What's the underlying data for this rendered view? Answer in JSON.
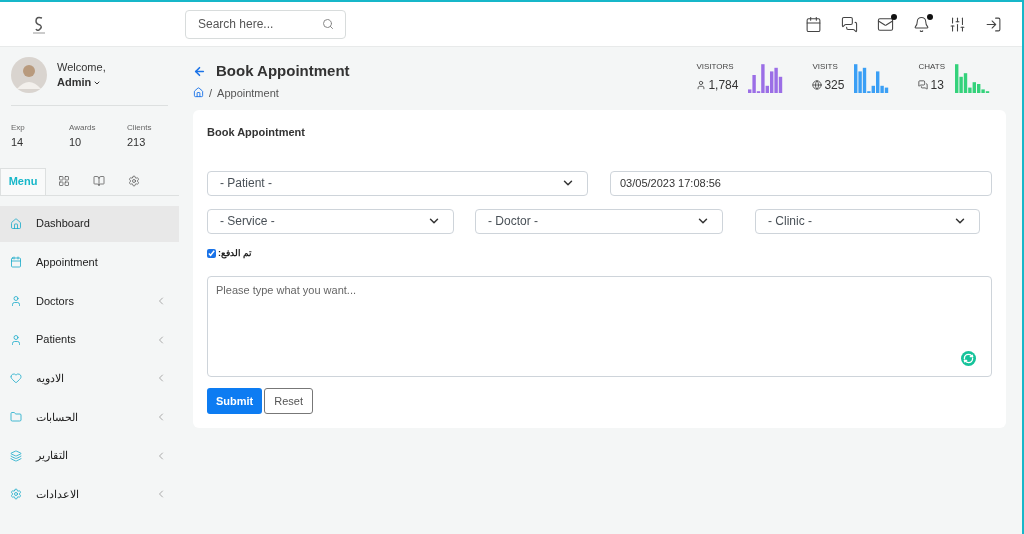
{
  "header": {
    "search": {
      "placeholder": "Search here..."
    },
    "notifications": [
      {
        "kind": "calendar",
        "dot": false
      },
      {
        "kind": "chat",
        "dot": false
      },
      {
        "kind": "mail",
        "dot": true
      },
      {
        "kind": "bell",
        "dot": true
      },
      {
        "kind": "sliders",
        "dot": false
      },
      {
        "kind": "logout",
        "dot": false
      }
    ]
  },
  "profile": {
    "greeting": "Welcome,",
    "name": "Admin",
    "stats": [
      {
        "label": "Exp",
        "value": "14"
      },
      {
        "label": "Awards",
        "value": "10"
      },
      {
        "label": "Clients",
        "value": "213"
      }
    ]
  },
  "sidebar_tabs": [
    {
      "kind": "text",
      "label": "Menu",
      "selected": true
    },
    {
      "kind": "grid",
      "selected": false
    },
    {
      "kind": "book",
      "selected": false
    },
    {
      "kind": "gear",
      "selected": false
    }
  ],
  "sidebar": {
    "items": [
      {
        "kind": "home",
        "label": "Dashboard",
        "selected": true,
        "expandable": false
      },
      {
        "kind": "calendar",
        "label": "Appointment",
        "selected": false,
        "expandable": false
      },
      {
        "kind": "user",
        "label": "Doctors",
        "selected": false,
        "expandable": true
      },
      {
        "kind": "user",
        "label": "Patients",
        "selected": false,
        "expandable": true
      },
      {
        "kind": "heart",
        "label": "الادويه",
        "selected": false,
        "expandable": true
      },
      {
        "kind": "folder",
        "label": "الحسابات",
        "selected": false,
        "expandable": true
      },
      {
        "kind": "layers",
        "label": "التقارير",
        "selected": false,
        "expandable": true
      },
      {
        "kind": "gear",
        "label": "الاعدادات",
        "selected": false,
        "expandable": true
      }
    ]
  },
  "page": {
    "title": "Book Appointment",
    "separator": "/",
    "breadcrumb": "Appointment"
  },
  "stats": [
    {
      "label": "VISITORS",
      "kind": "user",
      "value": "1,784",
      "color": "#9b6ee6"
    },
    {
      "label": "VISITS",
      "kind": "globe",
      "value": "325",
      "color": "#3a9ff5"
    },
    {
      "label": "CHATS",
      "kind": "chat",
      "value": "13",
      "color": "#34d27b"
    }
  ],
  "form": {
    "title": "Book Appointment",
    "patient": "- Patient -",
    "datetime": "03/05/2023 17:08:56",
    "service": "- Service -",
    "doctor": "- Doctor -",
    "clinic": "- Clinic -",
    "paid": {
      "label": "تم الدفع:",
      "checked": true
    },
    "message": {
      "placeholder": "Please type what you want..."
    },
    "buttons": [
      {
        "kind": "primary",
        "label": "Submit"
      },
      {
        "kind": "secondary",
        "label": "Reset"
      }
    ]
  }
}
